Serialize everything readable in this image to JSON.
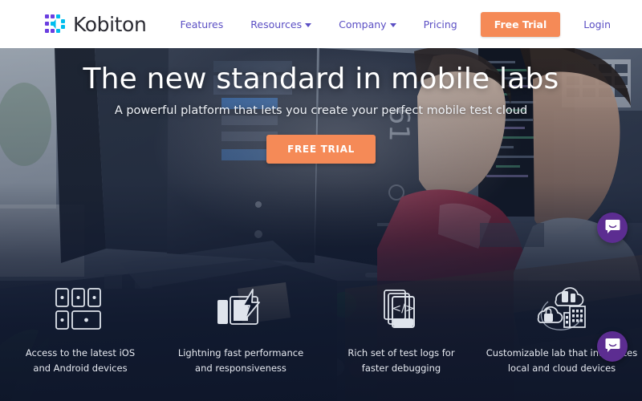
{
  "brand": {
    "name": "Kobiton",
    "logo_icon": "kobiton-grid-logo-icon",
    "logo_purple": "#6b3fe0",
    "logo_cyan": "#00c2ef"
  },
  "header": {
    "background": "#ffffff",
    "nav_color": "#5b4fc4",
    "cta_color": "#f58a57",
    "items": [
      {
        "label": "Features",
        "has_dropdown": false,
        "name": "nav-features"
      },
      {
        "label": "Resources",
        "has_dropdown": true,
        "name": "nav-resources"
      },
      {
        "label": "Company",
        "has_dropdown": true,
        "name": "nav-company"
      },
      {
        "label": "Pricing",
        "has_dropdown": false,
        "name": "nav-pricing"
      }
    ],
    "cta_label": "Free Trial",
    "login_label": "Login"
  },
  "hero": {
    "title": "The new standard in mobile labs",
    "subtitle": "A powerful platform that lets you create your perfect mobile test cloud",
    "cta_label": "FREE TRIAL",
    "cta_color": "#f58a57",
    "overlay_color": "#0f182d"
  },
  "features": [
    {
      "icon": "devices-grid-icon",
      "line1": "Access to the latest iOS",
      "line2": "and Android devices"
    },
    {
      "icon": "lightning-bolt-icon",
      "line1": "Lightning fast performance",
      "line2": "and responsiveness"
    },
    {
      "icon": "code-documents-icon",
      "line1": "Rich set of test logs for",
      "line2": "faster debugging"
    },
    {
      "icon": "cloud-lock-building-icon",
      "line1": "Customizable lab that integrates",
      "line2": "local and cloud devices"
    }
  ],
  "chat": {
    "icon": "chat-bubble-icon",
    "color": "#5c2d91",
    "launchers": [
      {
        "name": "chat-launcher-top"
      },
      {
        "name": "chat-launcher-bottom"
      }
    ]
  }
}
